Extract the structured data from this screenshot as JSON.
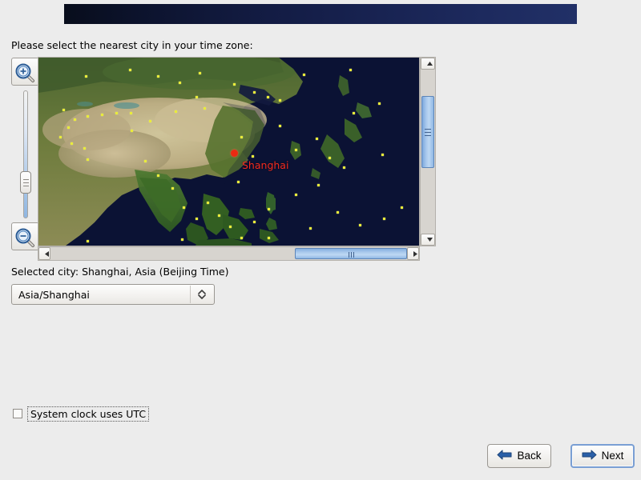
{
  "banner": {
    "gradient_from": "#080d1c",
    "gradient_to": "#213067"
  },
  "prompt": {
    "text": "Please select the nearest city in your time zone:"
  },
  "map": {
    "zoom_in_label": "zoom-in",
    "zoom_out_label": "zoom-out",
    "slider_value": "",
    "selected_city_marker": "Shanghai",
    "marker_label": "Shanghai",
    "marker_color": "#f32a1e",
    "city_dot_color": "#e9ec3a",
    "ocean_color": "#0a1030",
    "scroll": {
      "up_arrow": "▲",
      "down_arrow": "▼",
      "left_arrow": "◀",
      "right_arrow": "▶"
    }
  },
  "selection": {
    "selected_city_line": "Selected city: Shanghai, Asia (Beijing Time)",
    "timezone_value": "Asia/Shanghai"
  },
  "options": {
    "utc_label": "System clock uses UTC",
    "utc_checked": false
  },
  "navigation": {
    "back_label": "Back",
    "next_label": "Next",
    "arrow_color": "#2a5fa8"
  }
}
